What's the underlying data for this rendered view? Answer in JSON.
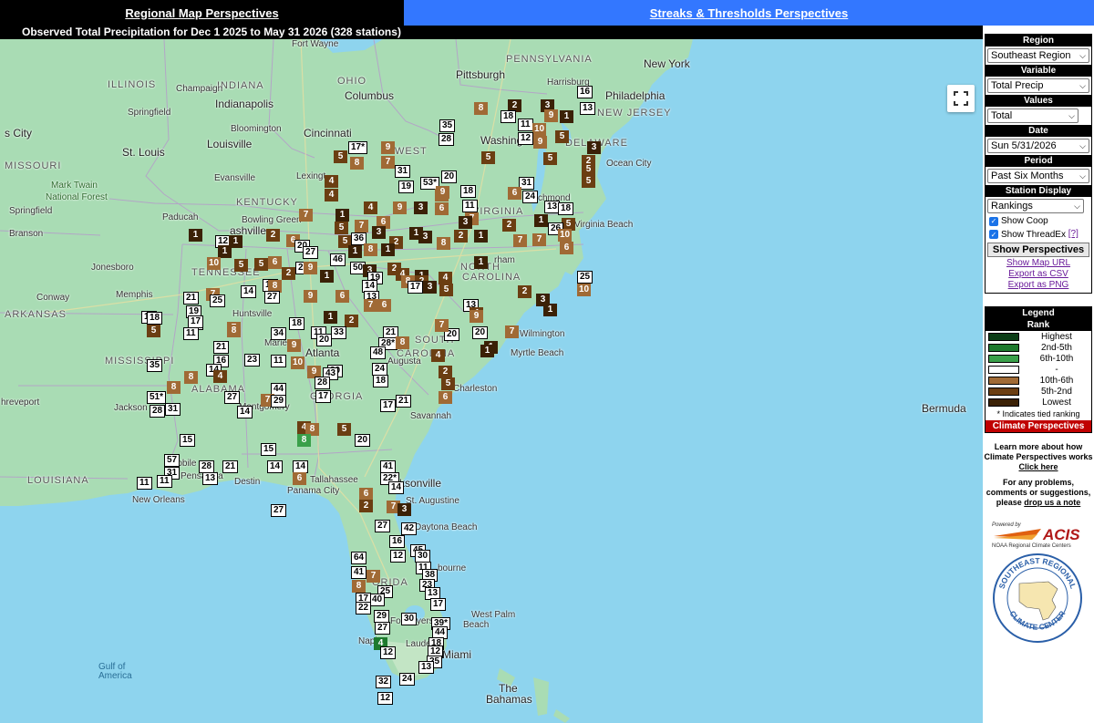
{
  "tabs": {
    "regional": "Regional Map Perspectives",
    "streaks": "Streaks & Thresholds Perspectives"
  },
  "map_title": "Observed Total Precipitation for Dec 1 2025 to May 31 2026 (328 stations)",
  "controls": {
    "region": {
      "label": "Region",
      "value": "Southeast Region"
    },
    "variable": {
      "label": "Variable",
      "value": "Total Precip"
    },
    "values": {
      "label": "Values",
      "value": "Total"
    },
    "date": {
      "label": "Date",
      "value": "Sun 5/31/2026"
    },
    "period": {
      "label": "Period",
      "value": "Past Six Months"
    },
    "station_display": {
      "label": "Station Display",
      "value": "Rankings"
    },
    "show_coop": "Show Coop",
    "show_threadex": "Show ThreadEx",
    "threadex_help": "[?]",
    "show_button": "Show Perspectives",
    "show_map_url": "Show Map URL",
    "export_csv": "Export as CSV",
    "export_png": "Export as PNG"
  },
  "legend": {
    "title": "Legend",
    "subtitle": "Rank",
    "rows": [
      {
        "label": "Highest",
        "color": "#0b3d16"
      },
      {
        "label": "2nd-5th",
        "color": "#1e7a2e"
      },
      {
        "label": "6th-10th",
        "color": "#3aa04a"
      },
      {
        "label": "-",
        "color": "#ffffff"
      },
      {
        "label": "10th-6th",
        "color": "#a06a35"
      },
      {
        "label": "5th-2nd",
        "color": "#6b3e12"
      },
      {
        "label": "Lowest",
        "color": "#3b2106"
      }
    ],
    "tied_note": "* Indicates tied ranking",
    "cp_label": "Climate Perspectives"
  },
  "info": {
    "learn": "Learn more about how Climate Perspectives works",
    "click_here": "Click here",
    "problems": "For any problems, comments or suggestions, please",
    "drop_note": "drop us a note",
    "powered_by": "Powered by",
    "acis": "ACIS",
    "noaa_rcc": "NOAA Regional Climate Centers",
    "sercc_top": "SOUTHEAST REGIONAL",
    "sercc_bottom": "CLIMATE CENTER"
  },
  "places": [
    {
      "t": "Fort Wayne",
      "c": "place"
    },
    {
      "t": "PENNSYLVANIA",
      "c": "place state"
    },
    {
      "t": "New York",
      "c": "place big"
    },
    {
      "t": "Pittsburgh",
      "c": "place big"
    },
    {
      "t": "ILLINOIS",
      "c": "place state"
    },
    {
      "t": "INDIANA",
      "c": "place state"
    },
    {
      "t": "OHIO",
      "c": "place state"
    },
    {
      "t": "Columbus",
      "c": "place big"
    },
    {
      "t": "Harrisburg",
      "c": "place"
    },
    {
      "t": "Philadelphia",
      "c": "place big"
    },
    {
      "t": "Champaign",
      "c": "place"
    },
    {
      "t": "Indianapolis",
      "c": "place big"
    },
    {
      "t": "Springfield",
      "c": "place"
    },
    {
      "t": "NEW JERSEY",
      "c": "place state"
    },
    {
      "t": "s City",
      "c": "place big"
    },
    {
      "t": "Bloomington",
      "c": "place"
    },
    {
      "t": "Cincinnati",
      "c": "place big"
    },
    {
      "t": "Washing",
      "c": "place big"
    },
    {
      "t": "DELAWARE",
      "c": "place state"
    },
    {
      "t": "WEST",
      "c": "place state"
    },
    {
      "t": "MISSOURI",
      "c": "place state"
    },
    {
      "t": "St. Louis",
      "c": "place big"
    },
    {
      "t": "Louisville",
      "c": "place big"
    },
    {
      "t": "Evansville",
      "c": "place"
    },
    {
      "t": "Lexingt",
      "c": "place"
    },
    {
      "t": "Ocean City",
      "c": "place"
    },
    {
      "t": "Mark Twain",
      "c": "place forest"
    },
    {
      "t": "National Forest",
      "c": "place forest"
    },
    {
      "t": "KENTUCKY",
      "c": "place state"
    },
    {
      "t": "VIRGINIA",
      "c": "place state"
    },
    {
      "t": "chmond",
      "c": "place"
    },
    {
      "t": "Springfield",
      "c": "place"
    },
    {
      "t": "Paducah",
      "c": "place"
    },
    {
      "t": "Bowling Green",
      "c": "place"
    },
    {
      "t": "Virginia Beach",
      "c": "place"
    },
    {
      "t": "Branson",
      "c": "place"
    },
    {
      "t": "ashville",
      "c": "place big"
    },
    {
      "t": "TENNESSEE",
      "c": "place state"
    },
    {
      "t": "Jonesboro",
      "c": "place"
    },
    {
      "t": "Memphis",
      "c": "place"
    },
    {
      "t": "Conway",
      "c": "place"
    },
    {
      "t": "NORTH",
      "c": "place state"
    },
    {
      "t": "CAROLINA",
      "c": "place state"
    },
    {
      "t": "rham",
      "c": "place"
    },
    {
      "t": "ARKANSAS",
      "c": "place state"
    },
    {
      "t": "Huntsville",
      "c": "place"
    },
    {
      "t": "Wilmington",
      "c": "place"
    },
    {
      "t": "Atlanta",
      "c": "place big"
    },
    {
      "t": "Marietta",
      "c": "place"
    },
    {
      "t": "SOUTH",
      "c": "place state"
    },
    {
      "t": "CAROLINA",
      "c": "place state"
    },
    {
      "t": "Myrtle Beach",
      "c": "place"
    },
    {
      "t": "MISSISSIPPI",
      "c": "place state"
    },
    {
      "t": "ALABAMA",
      "c": "place state"
    },
    {
      "t": "Augusta",
      "c": "place"
    },
    {
      "t": "GEORGIA",
      "c": "place state"
    },
    {
      "t": "Montgomery",
      "c": "place"
    },
    {
      "t": "Charleston",
      "c": "place"
    },
    {
      "t": "hreveport",
      "c": "place"
    },
    {
      "t": "Jackson",
      "c": "place"
    },
    {
      "t": "Savannah",
      "c": "place"
    },
    {
      "t": "Bermuda",
      "c": "place big"
    },
    {
      "t": "LOUISIANA",
      "c": "place state"
    },
    {
      "t": "Mobile",
      "c": "place"
    },
    {
      "t": "Pensacola",
      "c": "place"
    },
    {
      "t": "Destin",
      "c": "place"
    },
    {
      "t": "Tallahassee",
      "c": "place"
    },
    {
      "t": "cksonville",
      "c": "place big"
    },
    {
      "t": "New Orleans",
      "c": "place"
    },
    {
      "t": "Panama City",
      "c": "place"
    },
    {
      "t": "St. Augustine",
      "c": "place"
    },
    {
      "t": "Daytona Beach",
      "c": "place"
    },
    {
      "t": "do",
      "c": "place big"
    },
    {
      "t": "Tam",
      "c": "place big"
    },
    {
      "t": "ORIDA",
      "c": "place state"
    },
    {
      "t": "bourne",
      "c": "place"
    },
    {
      "t": "West Palm",
      "c": "place"
    },
    {
      "t": "Beach",
      "c": "place"
    },
    {
      "t": "Fort Myers",
      "c": "place"
    },
    {
      "t": "Napl",
      "c": "place"
    },
    {
      "t": "Lauder",
      "c": "place"
    },
    {
      "t": "Miami",
      "c": "place big"
    },
    {
      "t": "Gulf of",
      "c": "place water"
    },
    {
      "t": "America",
      "c": "place water"
    },
    {
      "t": "The",
      "c": "place big"
    },
    {
      "t": "Bahamas",
      "c": "place big"
    }
  ],
  "markers": [
    {
      "t": "2",
      "c": "low"
    },
    {
      "t": "3",
      "c": "low"
    },
    {
      "t": "16",
      "c": "neutral"
    },
    {
      "t": "8",
      "c": "hi10"
    },
    {
      "t": "18",
      "c": "neutral"
    },
    {
      "t": "11",
      "c": "neutral"
    },
    {
      "t": "9",
      "c": "hi10"
    },
    {
      "t": "1",
      "c": "low"
    },
    {
      "t": "13",
      "c": "neutral"
    },
    {
      "t": "35",
      "c": "neutral"
    },
    {
      "t": "28",
      "c": "neutral"
    },
    {
      "t": "10",
      "c": "hi10"
    },
    {
      "t": "5",
      "c": "mid"
    },
    {
      "t": "12",
      "c": "neutral"
    },
    {
      "t": "9",
      "c": "hi10"
    },
    {
      "t": "3",
      "c": "low"
    },
    {
      "t": "17*",
      "c": "neutral"
    },
    {
      "t": "9",
      "c": "hi10"
    },
    {
      "t": "5",
      "c": "mid"
    },
    {
      "t": "8",
      "c": "hi10"
    },
    {
      "t": "7",
      "c": "hi10"
    },
    {
      "t": "5",
      "c": "mid"
    },
    {
      "t": "2",
      "c": "mid"
    },
    {
      "t": "5",
      "c": "mid"
    },
    {
      "t": "31",
      "c": "neutral"
    },
    {
      "t": "20",
      "c": "neutral"
    },
    {
      "t": "4",
      "c": "mid"
    },
    {
      "t": "19",
      "c": "neutral"
    },
    {
      "t": "53*",
      "c": "neutral"
    },
    {
      "t": "8",
      "c": "hi10"
    },
    {
      "t": "9",
      "c": "hi10"
    },
    {
      "t": "18",
      "c": "neutral"
    },
    {
      "t": "5",
      "c": "mid"
    },
    {
      "t": "31",
      "c": "neutral"
    },
    {
      "t": "24",
      "c": "neutral"
    },
    {
      "t": "5",
      "c": "mid"
    },
    {
      "t": "4",
      "c": "mid"
    },
    {
      "t": "11",
      "c": "neutral"
    },
    {
      "t": "6",
      "c": "hi10"
    },
    {
      "t": "13",
      "c": "neutral"
    },
    {
      "t": "18",
      "c": "neutral"
    },
    {
      "t": "7",
      "c": "hi10"
    },
    {
      "t": "1",
      "c": "low"
    },
    {
      "t": "4",
      "c": "mid"
    },
    {
      "t": "9",
      "c": "hi10"
    },
    {
      "t": "3",
      "c": "low"
    },
    {
      "t": "6",
      "c": "hi10"
    },
    {
      "t": "7",
      "c": "hi10"
    },
    {
      "t": "1",
      "c": "low"
    },
    {
      "t": "5",
      "c": "mid"
    },
    {
      "t": "5",
      "c": "mid"
    },
    {
      "t": "7",
      "c": "hi10"
    },
    {
      "t": "6",
      "c": "hi10"
    },
    {
      "t": "3",
      "c": "low"
    },
    {
      "t": "2",
      "c": "mid"
    },
    {
      "t": "26",
      "c": "neutral"
    },
    {
      "t": "10",
      "c": "hi10"
    },
    {
      "t": "1",
      "c": "low"
    },
    {
      "t": "12",
      "c": "neutral"
    },
    {
      "t": "1",
      "c": "low"
    },
    {
      "t": "2",
      "c": "mid"
    },
    {
      "t": "6",
      "c": "hi10"
    },
    {
      "t": "5",
      "c": "mid"
    },
    {
      "t": "36",
      "c": "neutral"
    },
    {
      "t": "3",
      "c": "low"
    },
    {
      "t": "2",
      "c": "mid"
    },
    {
      "t": "1",
      "c": "low"
    },
    {
      "t": "3",
      "c": "low"
    },
    {
      "t": "8",
      "c": "hi10"
    },
    {
      "t": "2",
      "c": "mid"
    },
    {
      "t": "1",
      "c": "low"
    },
    {
      "t": "7",
      "c": "hi10"
    },
    {
      "t": "7",
      "c": "hi10"
    },
    {
      "t": "6",
      "c": "hi10"
    },
    {
      "t": "1",
      "c": "low"
    },
    {
      "t": "20",
      "c": "neutral"
    },
    {
      "t": "27",
      "c": "neutral"
    },
    {
      "t": "46",
      "c": "neutral"
    },
    {
      "t": "1",
      "c": "low"
    },
    {
      "t": "8",
      "c": "hi10"
    },
    {
      "t": "1",
      "c": "low"
    },
    {
      "t": "10",
      "c": "hi10"
    },
    {
      "t": "5",
      "c": "mid"
    },
    {
      "t": "5",
      "c": "mid"
    },
    {
      "t": "6",
      "c": "hi10"
    },
    {
      "t": "2",
      "c": "mid"
    },
    {
      "t": "25",
      "c": "neutral"
    },
    {
      "t": "9",
      "c": "hi10"
    },
    {
      "t": "50",
      "c": "neutral"
    },
    {
      "t": "3",
      "c": "low"
    },
    {
      "t": "2",
      "c": "mid"
    },
    {
      "t": "4",
      "c": "mid"
    },
    {
      "t": "1",
      "c": "low"
    },
    {
      "t": "4",
      "c": "mid"
    },
    {
      "t": "1",
      "c": "low"
    },
    {
      "t": "25",
      "c": "neutral"
    },
    {
      "t": "1",
      "c": "low"
    },
    {
      "t": "16",
      "c": "neutral"
    },
    {
      "t": "14",
      "c": "neutral"
    },
    {
      "t": "19",
      "c": "neutral"
    },
    {
      "t": "14",
      "c": "neutral"
    },
    {
      "t": "8",
      "c": "hi10"
    },
    {
      "t": "8",
      "c": "hi10"
    },
    {
      "t": "2",
      "c": "mid"
    },
    {
      "t": "3",
      "c": "low"
    },
    {
      "t": "5",
      "c": "mid"
    },
    {
      "t": "10",
      "c": "hi10"
    },
    {
      "t": "7",
      "c": "hi10"
    },
    {
      "t": "27",
      "c": "neutral"
    },
    {
      "t": "9",
      "c": "hi10"
    },
    {
      "t": "6",
      "c": "hi10"
    },
    {
      "t": "13",
      "c": "neutral"
    },
    {
      "t": "7",
      "c": "hi10"
    },
    {
      "t": "6",
      "c": "hi10"
    },
    {
      "t": "17",
      "c": "neutral"
    },
    {
      "t": "2",
      "c": "mid"
    },
    {
      "t": "13",
      "c": "neutral"
    },
    {
      "t": "4",
      "c": "mid"
    },
    {
      "t": "9",
      "c": "hi10"
    },
    {
      "t": "3",
      "c": "low"
    },
    {
      "t": "1",
      "c": "low"
    },
    {
      "t": "21",
      "c": "neutral"
    },
    {
      "t": "18",
      "c": "neutral"
    },
    {
      "t": "25",
      "c": "neutral"
    },
    {
      "t": "1",
      "c": "low"
    },
    {
      "t": "2",
      "c": "mid"
    },
    {
      "t": "17",
      "c": "neutral"
    },
    {
      "t": "7",
      "c": "hi10"
    },
    {
      "t": "18",
      "c": "neutral"
    },
    {
      "t": "19",
      "c": "neutral"
    },
    {
      "t": "17",
      "c": "neutral"
    },
    {
      "t": "5",
      "c": "mid"
    },
    {
      "t": "8",
      "c": "hi10"
    },
    {
      "t": "34",
      "c": "neutral"
    },
    {
      "t": "18",
      "c": "neutral"
    },
    {
      "t": "11",
      "c": "neutral"
    },
    {
      "t": "33",
      "c": "neutral"
    },
    {
      "t": "21",
      "c": "neutral"
    },
    {
      "t": "20",
      "c": "neutral"
    },
    {
      "t": "7",
      "c": "hi10"
    },
    {
      "t": "20",
      "c": "neutral"
    },
    {
      "t": "7",
      "c": "hi10"
    },
    {
      "t": "9",
      "c": "hi10"
    },
    {
      "t": "11",
      "c": "neutral"
    },
    {
      "t": "20",
      "c": "neutral"
    },
    {
      "t": "28*",
      "c": "neutral"
    },
    {
      "t": "8",
      "c": "hi10"
    },
    {
      "t": "1",
      "c": "low"
    },
    {
      "t": "1",
      "c": "low"
    },
    {
      "t": "21",
      "c": "neutral"
    },
    {
      "t": "16",
      "c": "neutral"
    },
    {
      "t": "23",
      "c": "neutral"
    },
    {
      "t": "11",
      "c": "neutral"
    },
    {
      "t": "10",
      "c": "hi10"
    },
    {
      "t": "20",
      "c": "neutral"
    },
    {
      "t": "48",
      "c": "neutral"
    },
    {
      "t": "4",
      "c": "mid"
    },
    {
      "t": "35",
      "c": "neutral"
    },
    {
      "t": "14",
      "c": "neutral"
    },
    {
      "t": "8",
      "c": "hi10"
    },
    {
      "t": "4",
      "c": "mid"
    },
    {
      "t": "9",
      "c": "hi10"
    },
    {
      "t": "43",
      "c": "neutral"
    },
    {
      "t": "24",
      "c": "neutral"
    },
    {
      "t": "2",
      "c": "mid"
    },
    {
      "t": "5",
      "c": "mid"
    },
    {
      "t": "8",
      "c": "hi10"
    },
    {
      "t": "31",
      "c": "neutral"
    },
    {
      "t": "44",
      "c": "neutral"
    },
    {
      "t": "28",
      "c": "neutral"
    },
    {
      "t": "18",
      "c": "neutral"
    },
    {
      "t": "6",
      "c": "hi10"
    },
    {
      "t": "51*",
      "c": "neutral"
    },
    {
      "t": "27",
      "c": "neutral"
    },
    {
      "t": "7",
      "c": "hi10"
    },
    {
      "t": "29",
      "c": "neutral"
    },
    {
      "t": "17",
      "c": "neutral"
    },
    {
      "t": "21",
      "c": "neutral"
    },
    {
      "t": "28",
      "c": "neutral"
    },
    {
      "t": "14",
      "c": "neutral"
    },
    {
      "t": "17",
      "c": "neutral"
    },
    {
      "t": "4",
      "c": "mid"
    },
    {
      "t": "8",
      "c": "hi10"
    },
    {
      "t": "8",
      "c": "wet2"
    },
    {
      "t": "5",
      "c": "mid"
    },
    {
      "t": "20",
      "c": "neutral"
    },
    {
      "t": "15",
      "c": "neutral"
    },
    {
      "t": "15",
      "c": "neutral"
    },
    {
      "t": "57",
      "c": "neutral"
    },
    {
      "t": "31",
      "c": "neutral"
    },
    {
      "t": "28",
      "c": "neutral"
    },
    {
      "t": "13",
      "c": "neutral"
    },
    {
      "t": "21",
      "c": "neutral"
    },
    {
      "t": "14",
      "c": "neutral"
    },
    {
      "t": "14",
      "c": "neutral"
    },
    {
      "t": "6",
      "c": "hi10"
    },
    {
      "t": "41",
      "c": "neutral"
    },
    {
      "t": "22*",
      "c": "neutral"
    },
    {
      "t": "14",
      "c": "neutral"
    },
    {
      "t": "11",
      "c": "neutral"
    },
    {
      "t": "11",
      "c": "neutral"
    },
    {
      "t": "6",
      "c": "hi10"
    },
    {
      "t": "2",
      "c": "mid"
    },
    {
      "t": "7",
      "c": "hi10"
    },
    {
      "t": "3",
      "c": "low"
    },
    {
      "t": "27",
      "c": "neutral"
    },
    {
      "t": "27",
      "c": "neutral"
    },
    {
      "t": "42",
      "c": "neutral"
    },
    {
      "t": "16",
      "c": "neutral"
    },
    {
      "t": "45",
      "c": "neutral"
    },
    {
      "t": "12",
      "c": "neutral"
    },
    {
      "t": "30",
      "c": "neutral"
    },
    {
      "t": "64",
      "c": "neutral"
    },
    {
      "t": "11",
      "c": "neutral"
    },
    {
      "t": "41",
      "c": "neutral"
    },
    {
      "t": "7",
      "c": "hi10"
    },
    {
      "t": "38",
      "c": "neutral"
    },
    {
      "t": "8",
      "c": "hi10"
    },
    {
      "t": "23",
      "c": "neutral"
    },
    {
      "t": "25",
      "c": "neutral"
    },
    {
      "t": "13",
      "c": "neutral"
    },
    {
      "t": "17",
      "c": "neutral"
    },
    {
      "t": "40",
      "c": "neutral"
    },
    {
      "t": "17",
      "c": "neutral"
    },
    {
      "t": "22",
      "c": "neutral"
    },
    {
      "t": "29",
      "c": "neutral"
    },
    {
      "t": "30",
      "c": "neutral"
    },
    {
      "t": "39*",
      "c": "neutral"
    },
    {
      "t": "27",
      "c": "neutral"
    },
    {
      "t": "44",
      "c": "neutral"
    },
    {
      "t": "4",
      "c": "wet"
    },
    {
      "t": "12",
      "c": "neutral"
    },
    {
      "t": "18",
      "c": "neutral"
    },
    {
      "t": "12",
      "c": "neutral"
    },
    {
      "t": "25",
      "c": "neutral"
    },
    {
      "t": "13",
      "c": "neutral"
    },
    {
      "t": "32",
      "c": "neutral"
    },
    {
      "t": "24",
      "c": "neutral"
    },
    {
      "t": "12",
      "c": "neutral"
    }
  ]
}
